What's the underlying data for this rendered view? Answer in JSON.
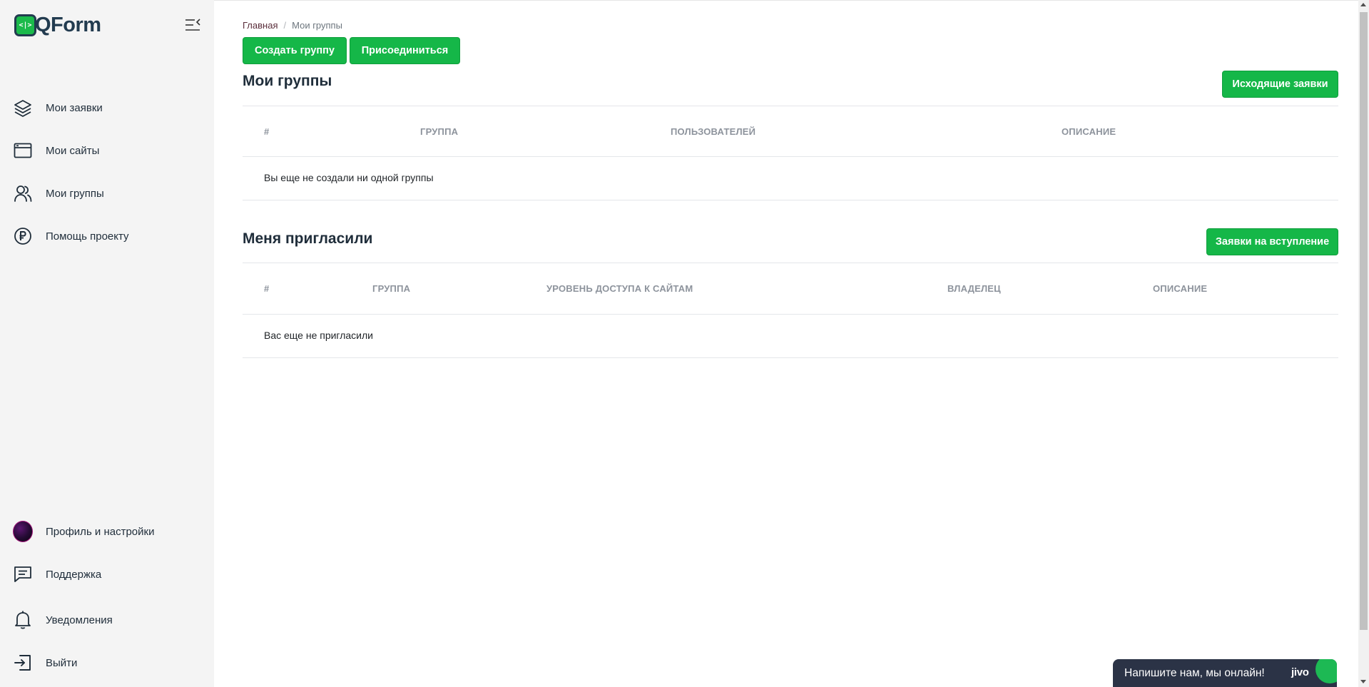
{
  "brand": {
    "name": "QForm",
    "mark": "<|>"
  },
  "sidebar": {
    "items": [
      {
        "label": "Мои заявки",
        "icon": "layers-icon"
      },
      {
        "label": "Мои сайты",
        "icon": "browser-window-icon"
      },
      {
        "label": "Мои группы",
        "icon": "users-icon"
      },
      {
        "label": "Помощь проекту",
        "icon": "ruble-coin-icon"
      }
    ],
    "bottom_items": [
      {
        "label": "Профиль и настройки",
        "icon": "avatar"
      },
      {
        "label": "Поддержка",
        "icon": "chat-bubble-icon"
      },
      {
        "label": "Уведомления",
        "icon": "bell-icon"
      },
      {
        "label": "Выйти",
        "icon": "logout-icon"
      }
    ]
  },
  "breadcrumb": {
    "home": "Главная",
    "separator": "/",
    "current": "Мои группы"
  },
  "toolbar": {
    "create_group": "Создать группу",
    "join": "Присоединиться"
  },
  "my_groups": {
    "title": "Мои группы",
    "action": "Исходящие заявки",
    "columns": [
      "#",
      "Группа",
      "Пользователей",
      "Описание"
    ],
    "empty": "Вы еще не создали ни одной группы"
  },
  "invited": {
    "title": "Меня пригласили",
    "action": "Заявки на вступление",
    "columns": [
      "#",
      "Группа",
      "Уровень доступа к сайтам",
      "Владелец",
      "Описание"
    ],
    "empty": "Вас еще не пригласили"
  },
  "chat": {
    "text": "Напишите нам, мы онлайн!",
    "logo": "jivo"
  },
  "colors": {
    "primary": "#15b748",
    "sidebar_bg": "#f4f4f4",
    "text_dark": "#1f2d3a",
    "header_muted": "#8d939c"
  }
}
